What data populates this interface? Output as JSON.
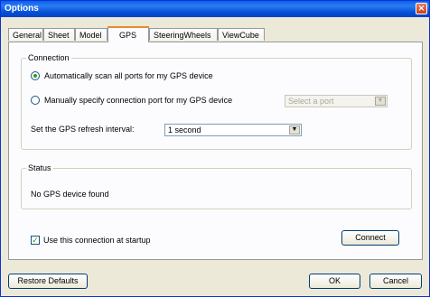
{
  "window": {
    "title": "Options",
    "close_glyph": "×"
  },
  "tabs": [
    {
      "label": "General",
      "active": false
    },
    {
      "label": "Sheet",
      "active": false
    },
    {
      "label": "Model",
      "active": false
    },
    {
      "label": "GPS",
      "active": true
    },
    {
      "label": "SteeringWheels",
      "active": false
    },
    {
      "label": "ViewCube",
      "active": false
    }
  ],
  "connection": {
    "legend": "Connection",
    "auto_scan_label": "Automatically scan all ports for my GPS device",
    "auto_scan_selected": true,
    "manual_label": "Manually specify connection port for my GPS device",
    "manual_selected": false,
    "port_select": {
      "value": "Select a port",
      "disabled": true
    },
    "refresh_label": "Set the GPS refresh interval:",
    "refresh_select": {
      "value": "1 second"
    }
  },
  "status": {
    "legend": "Status",
    "message": "No GPS device found"
  },
  "startup": {
    "checkbox_label": "Use this connection at startup",
    "checked": true
  },
  "buttons": {
    "connect": "Connect",
    "restore_defaults": "Restore Defaults",
    "ok": "OK",
    "cancel": "Cancel"
  },
  "icons": {
    "dropdown": "chevron-down-icon",
    "close": "close-icon",
    "checkmark": "checkmark-icon"
  }
}
